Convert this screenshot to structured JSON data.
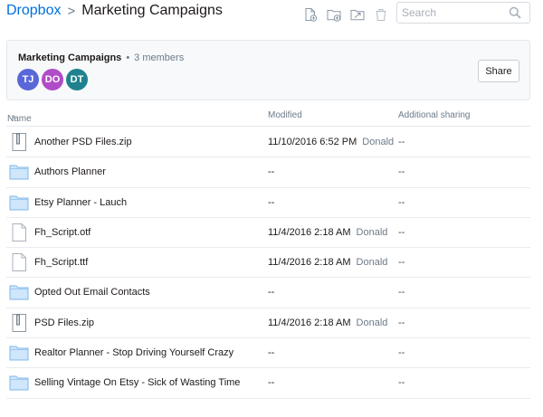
{
  "breadcrumb": {
    "root": "Dropbox",
    "separator": ">",
    "current": "Marketing Campaigns"
  },
  "toolbar": {
    "icons": [
      "new-file-icon",
      "new-folder-icon",
      "upload-folder-icon",
      "trash-icon"
    ]
  },
  "search": {
    "placeholder": "Search",
    "value": ""
  },
  "team": {
    "name": "Marketing Campaigns",
    "bullet": "•",
    "members": "3 members",
    "avatars": [
      {
        "initials": "TJ",
        "color": "#5a67d8"
      },
      {
        "initials": "DO",
        "color": "#b04cc8"
      },
      {
        "initials": "DT",
        "color": "#20828f"
      }
    ],
    "share_label": "Share"
  },
  "table": {
    "headers": {
      "name": "Name",
      "modified": "Modified",
      "sharing": "Additional sharing"
    },
    "rows": [
      {
        "icon": "zip-file-icon",
        "name": "Another PSD Files.zip",
        "modified": "11/10/2016 6:52 PM",
        "by": "Donald",
        "sharing": "--"
      },
      {
        "icon": "folder-icon",
        "name": "Authors Planner",
        "modified": "--",
        "by": "",
        "sharing": "--"
      },
      {
        "icon": "folder-icon",
        "name": "Etsy Planner - Lauch",
        "modified": "--",
        "by": "",
        "sharing": "--"
      },
      {
        "icon": "file-icon",
        "name": "Fh_Script.otf",
        "modified": "11/4/2016 2:18 AM",
        "by": "Donald",
        "sharing": "--"
      },
      {
        "icon": "file-icon",
        "name": "Fh_Script.ttf",
        "modified": "11/4/2016 2:18 AM",
        "by": "Donald",
        "sharing": "--"
      },
      {
        "icon": "folder-icon",
        "name": "Opted Out Email Contacts",
        "modified": "--",
        "by": "",
        "sharing": "--"
      },
      {
        "icon": "zip-file-icon",
        "name": "PSD Files.zip",
        "modified": "11/4/2016 2:18 AM",
        "by": "Donald",
        "sharing": "--"
      },
      {
        "icon": "folder-icon",
        "name": "Realtor Planner - Stop Driving Yourself Crazy",
        "modified": "--",
        "by": "",
        "sharing": "--"
      },
      {
        "icon": "folder-icon",
        "name": "Selling Vintage On Etsy - Sick of Wasting Time",
        "modified": "--",
        "by": "",
        "sharing": "--"
      }
    ]
  },
  "colors": {
    "link": "#0070e0",
    "folder_fill": "#cfe6fb",
    "folder_stroke": "#7fb7ea"
  }
}
